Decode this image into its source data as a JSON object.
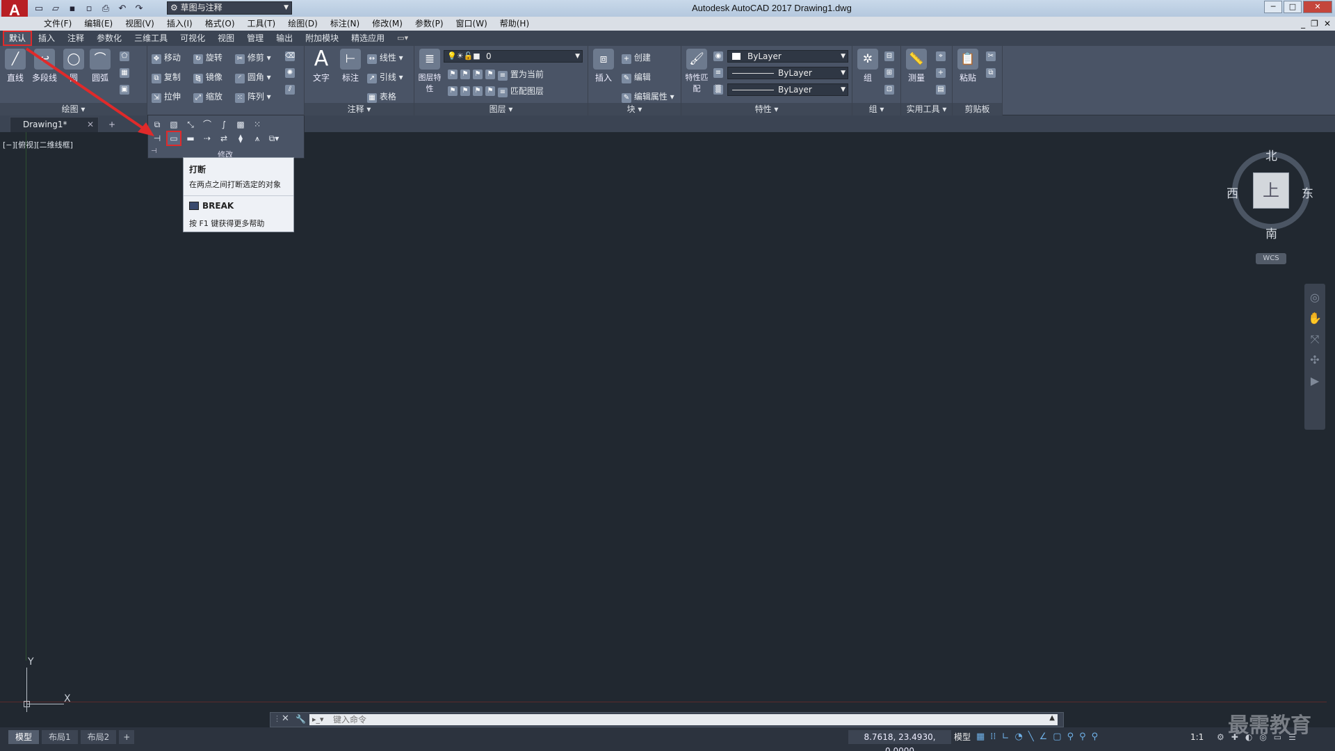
{
  "titlebar": {
    "app_logo": "A",
    "workspace": "草图与注释",
    "title": "Autodesk AutoCAD 2017    Drawing1.dwg",
    "controls": [
      "─",
      "□",
      "✕"
    ]
  },
  "menubar": [
    "文件(F)",
    "编辑(E)",
    "视图(V)",
    "插入(I)",
    "格式(O)",
    "工具(T)",
    "绘图(D)",
    "标注(N)",
    "修改(M)",
    "参数(P)",
    "窗口(W)",
    "帮助(H)"
  ],
  "ribbon_tabs": [
    "默认",
    "插入",
    "注释",
    "参数化",
    "三维工具",
    "可视化",
    "视图",
    "管理",
    "输出",
    "附加模块",
    "精选应用"
  ],
  "ribbon": {
    "draw": {
      "title": "绘图",
      "tools": [
        "直线",
        "多段线",
        "圆",
        "圆弧"
      ]
    },
    "modify": {
      "col1": [
        "移动",
        "复制",
        "拉伸"
      ],
      "col2": [
        "旋转",
        "镜像",
        "缩放"
      ],
      "col3": [
        "修剪",
        "圆角",
        "阵列"
      ],
      "title": "修改"
    },
    "annotation": {
      "title": "注释",
      "text": "文字",
      "dimension": "标注",
      "rows": [
        "线性",
        "引线",
        "表格"
      ]
    },
    "layers": {
      "title": "图层",
      "layer_props": "图层特性",
      "current_layer": "0",
      "rows": [
        "置为当前",
        "匹配图层"
      ]
    },
    "block": {
      "title": "块",
      "insert": "插入",
      "rows": [
        "创建",
        "编辑",
        "编辑属性"
      ]
    },
    "properties": {
      "title": "特性",
      "match": "特性匹配",
      "color": "ByLayer",
      "linetype": "ByLayer",
      "lineweight": "ByLayer"
    },
    "groups": {
      "title": "组",
      "group": "组"
    },
    "utilities": {
      "title": "实用工具",
      "measure": "测量"
    },
    "clipboard": {
      "title": "剪贴板",
      "paste": "粘贴"
    }
  },
  "doc_tab": {
    "label": "Drawing1*",
    "close": "✕",
    "new": "+"
  },
  "viewport_label": "[−][俯视][二维线框]",
  "viewcube": {
    "north": "北",
    "south": "南",
    "east": "东",
    "west": "西",
    "face": "上",
    "wcs": "WCS"
  },
  "ucs": {
    "x": "X",
    "y": "Y"
  },
  "tooltip": {
    "title": "打断",
    "description": "在两点之间打断选定的对象",
    "command": "BREAK",
    "help": "按 F1 键获得更多帮助"
  },
  "cmdline": {
    "placeholder": "键入命令"
  },
  "layout_tabs": [
    "模型",
    "布局1",
    "布局2",
    "+"
  ],
  "status": {
    "coords": "8.7618, 23.4930, 0.0000",
    "model": "模型",
    "scale": "1:1"
  },
  "watermark": "最需教育",
  "colors": {
    "accent": "#e02a2a",
    "canvas": "#212830",
    "ribbon": "#4a5466"
  }
}
